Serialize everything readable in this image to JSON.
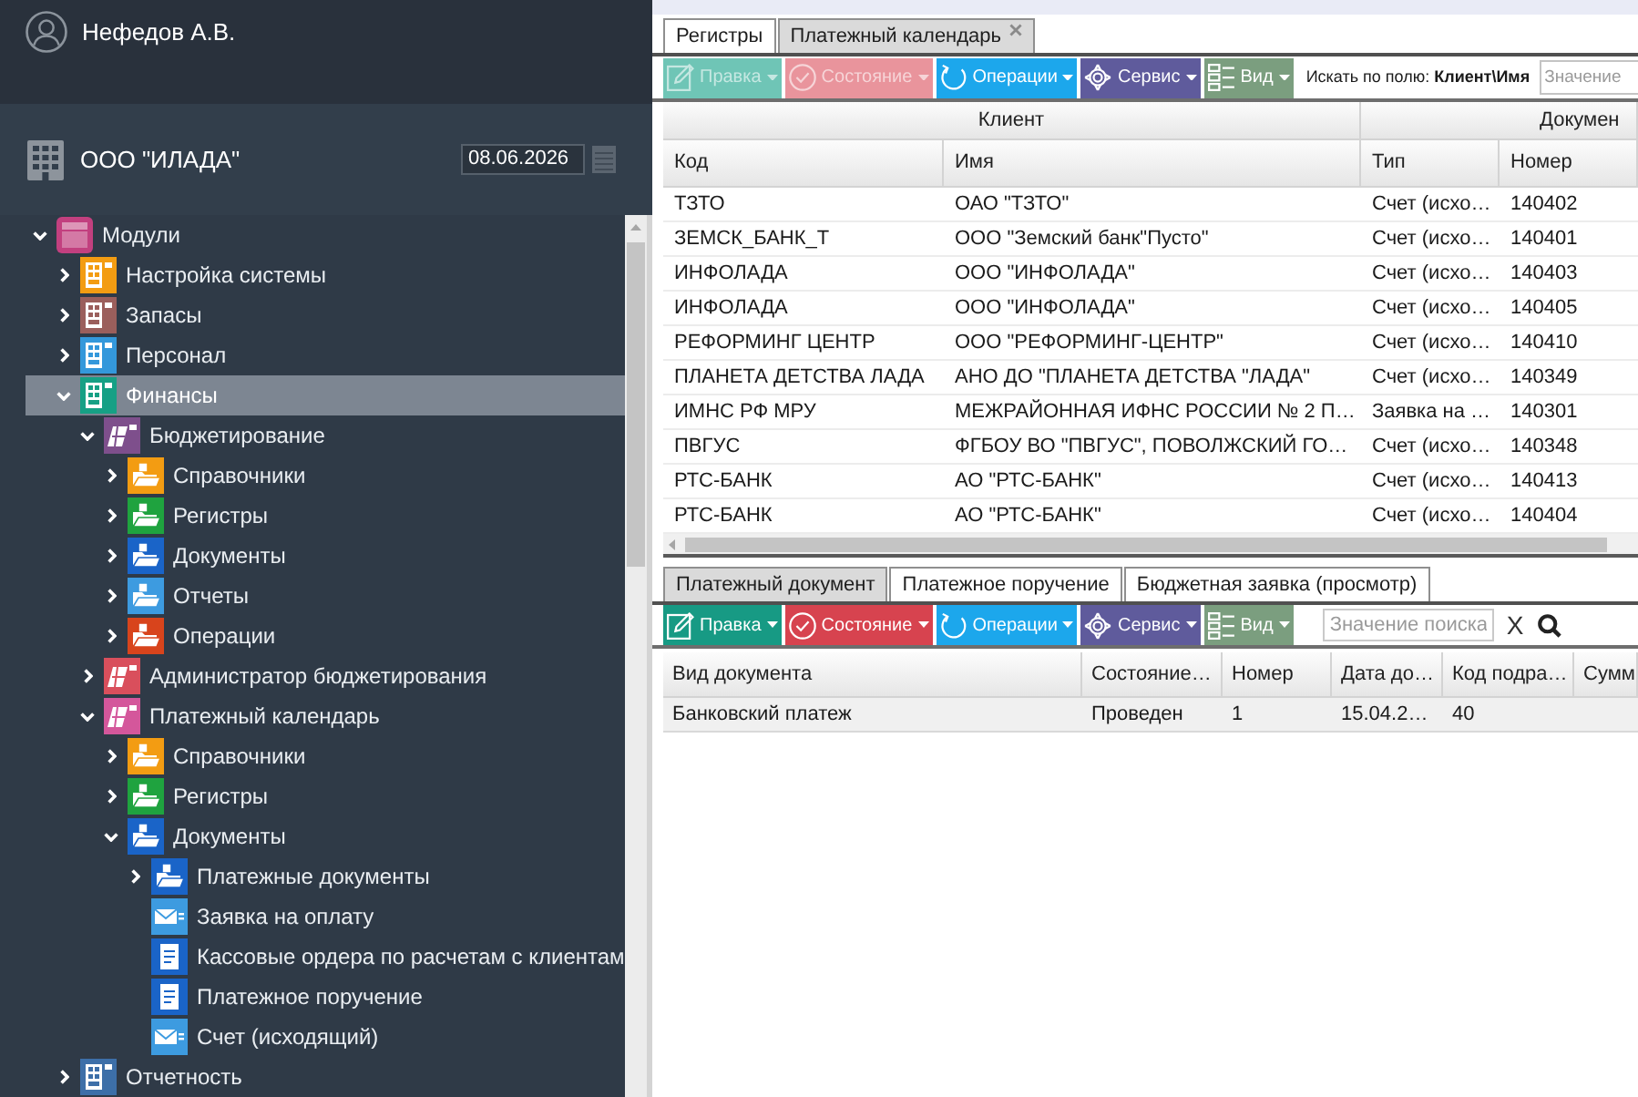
{
  "user": {
    "name": "Нефедов А.В."
  },
  "organization": {
    "name": "ООО \"ИЛАДА\"",
    "date": "08.06.2026"
  },
  "tree": [
    {
      "label": "Модули",
      "kind": "root",
      "color": "#c2407f",
      "expanded": true,
      "selected": false,
      "children": [
        {
          "label": "Настройка системы",
          "kind": "module",
          "color": "#f39c12",
          "expanded": false,
          "selected": false
        },
        {
          "label": "Запасы",
          "kind": "module",
          "color": "#9b5f5c",
          "expanded": false,
          "selected": false
        },
        {
          "label": "Персонал",
          "kind": "module",
          "color": "#3498db",
          "expanded": false,
          "selected": false
        },
        {
          "label": "Финансы",
          "kind": "module",
          "color": "#16a085",
          "expanded": true,
          "selected": true,
          "children": [
            {
              "label": "Бюджетирование",
              "kind": "group",
              "color": "#7e4f8c",
              "expanded": true,
              "selected": false,
              "children": [
                {
                  "label": "Справочники",
                  "kind": "folder",
                  "color": "#f39c12",
                  "expanded": false,
                  "selected": false
                },
                {
                  "label": "Регистры",
                  "kind": "folder",
                  "color": "#1fa33f",
                  "expanded": false,
                  "selected": false
                },
                {
                  "label": "Документы",
                  "kind": "folder",
                  "color": "#1a64c8",
                  "expanded": false,
                  "selected": false
                },
                {
                  "label": "Отчеты",
                  "kind": "folder",
                  "color": "#3d9be0",
                  "expanded": false,
                  "selected": false
                },
                {
                  "label": "Операции",
                  "kind": "folder",
                  "color": "#d8441c",
                  "expanded": false,
                  "selected": false
                }
              ]
            },
            {
              "label": "Администратор бюджетирования",
              "kind": "group",
              "color": "#d94f5c",
              "expanded": false,
              "selected": false
            },
            {
              "label": "Платежный календарь",
              "kind": "group",
              "color": "#d4579b",
              "expanded": true,
              "selected": false,
              "children": [
                {
                  "label": "Справочники",
                  "kind": "folder",
                  "color": "#f39c12",
                  "expanded": false,
                  "selected": false
                },
                {
                  "label": "Регистры",
                  "kind": "folder",
                  "color": "#1fa33f",
                  "expanded": false,
                  "selected": false
                },
                {
                  "label": "Документы",
                  "kind": "folder",
                  "color": "#1a64c8",
                  "expanded": true,
                  "selected": false,
                  "children": [
                    {
                      "label": "Платежные документы",
                      "kind": "folder",
                      "color": "#1a64c8",
                      "expanded": false,
                      "selected": false
                    },
                    {
                      "label": "Заявка на оплату",
                      "kind": "envelope",
                      "color": "#3d9be0",
                      "selected": false
                    },
                    {
                      "label": "Кассовые ордера по расчетам с клиентам",
                      "kind": "document",
                      "color": "#1a64c8",
                      "selected": false
                    },
                    {
                      "label": "Платежное поручение",
                      "kind": "document",
                      "color": "#1a64c8",
                      "selected": false
                    },
                    {
                      "label": "Счет (исходящий)",
                      "kind": "envelope",
                      "color": "#3d9be0",
                      "selected": false
                    }
                  ]
                }
              ]
            }
          ]
        },
        {
          "label": "Отчетность",
          "kind": "module",
          "color": "#3d6fa8",
          "expanded": false,
          "selected": false
        }
      ]
    }
  ],
  "top_tabs": [
    {
      "label": "Регистры",
      "selected": false,
      "closable": false
    },
    {
      "label": "Платежный календарь",
      "selected": true,
      "closable": true
    }
  ],
  "top_toolbar": {
    "buttons": [
      {
        "label": "Правка",
        "kind": "edit",
        "color": "#6fc5b6",
        "disabled": true
      },
      {
        "label": "Состояние",
        "kind": "status",
        "color": "#e9949c",
        "disabled": true
      },
      {
        "label": "Операции",
        "kind": "operations",
        "color": "#1ca7ec",
        "disabled": false
      },
      {
        "label": "Сервис",
        "kind": "service",
        "color": "#5f5b9c",
        "disabled": false
      },
      {
        "label": "Вид",
        "kind": "view",
        "color": "#7b9e7f",
        "disabled": false
      }
    ],
    "search_label": "Искать по полю: **Клиент\\Имя**",
    "search_field": {
      "placeholder": "Значение"
    }
  },
  "top_table": {
    "column_groups": [
      "Клиент",
      "Докумен"
    ],
    "columns": [
      "Код",
      "Имя",
      "Тип",
      "Номер"
    ],
    "rows": [
      [
        "ТЗТО",
        "ОАО \"ТЗТО\"",
        "Счет (исхо…",
        "140402"
      ],
      [
        "ЗЕМСК_БАНК_Т",
        "ООО \"Земский банк\"Пусто\"",
        "Счет (исхо…",
        "140401"
      ],
      [
        "ИНФОЛАДА",
        "ООО \"ИНФОЛАДА\"",
        "Счет (исхо…",
        "140403"
      ],
      [
        "ИНФОЛАДА",
        "ООО \"ИНФОЛАДА\"",
        "Счет (исхо…",
        "140405"
      ],
      [
        "РЕФОРМИНГ ЦЕНТР",
        "ООО \"РЕФОРМИНГ-ЦЕНТР\"",
        "Счет (исхо…",
        "140410"
      ],
      [
        "ПЛАНЕТА ДЕТСТВА ЛАДА",
        "АНО ДО \"ПЛАНЕТА ДЕТСТВА \"ЛАДА\"",
        "Счет (исхо…",
        "140349"
      ],
      [
        "ИМНС РФ МРУ",
        "МЕЖРАЙОННАЯ ИФНС РОССИИ № 2 П…",
        "Заявка на …",
        "140301"
      ],
      [
        "ПВГУС",
        "ФГБОУ ВО \"ПВГУС\", ПОВОЛЖСКИЙ ГО…",
        "Счет (исхо…",
        "140348"
      ],
      [
        "РТС-БАНК",
        "АО \"РТС-БАНК\"",
        "Счет (исхо…",
        "140413"
      ],
      [
        "РТС-БАНК",
        "АО \"РТС-БАНК\"",
        "Счет (исхо…",
        "140404"
      ]
    ]
  },
  "bottom_tabs": [
    {
      "label": "Платежный документ",
      "selected": true
    },
    {
      "label": "Платежное поручение",
      "selected": false
    },
    {
      "label": "Бюджетная заявка (просмотр)",
      "selected": false
    }
  ],
  "bottom_toolbar": {
    "buttons": [
      {
        "label": "Правка",
        "kind": "edit",
        "color": "#179a84",
        "disabled": false
      },
      {
        "label": "Состояние",
        "kind": "status",
        "color": "#d7434f",
        "disabled": false
      },
      {
        "label": "Операции",
        "kind": "operations",
        "color": "#1ca7ec",
        "disabled": false
      },
      {
        "label": "Сервис",
        "kind": "service",
        "color": "#5f5b9c",
        "disabled": false
      },
      {
        "label": "Вид",
        "kind": "view",
        "color": "#7b9e7f",
        "disabled": false
      }
    ],
    "search_field": {
      "placeholder": "Значение поиска"
    },
    "clear_label": "X"
  },
  "bottom_table": {
    "columns": [
      "Вид документа",
      "Состояние…",
      "Номер",
      "Дата до…",
      "Код подра…",
      "Сумм"
    ],
    "rows": [
      [
        "Банковский платеж",
        "Проведен",
        "1",
        "15.04.2…",
        "40"
      ]
    ]
  }
}
